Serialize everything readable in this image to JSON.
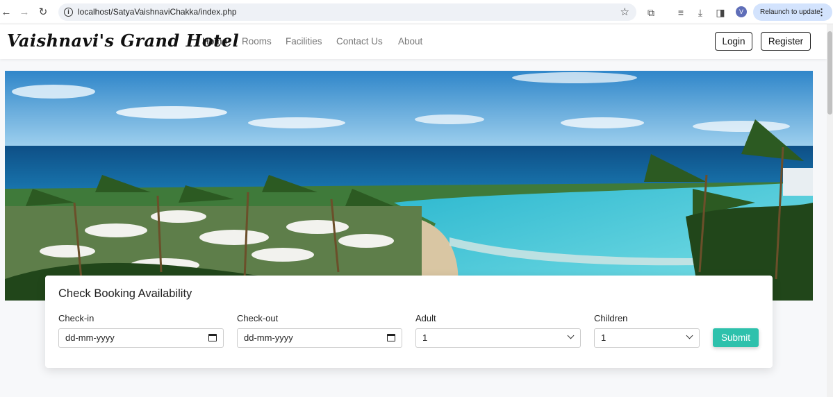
{
  "browser": {
    "url": "localhost/SatyaVaishnaviChakka/index.php",
    "profile_initial": "V",
    "relaunch_label": "Relaunch to update"
  },
  "site": {
    "brand": "Vaishnavi's Grand Hotel",
    "nav": [
      {
        "label": "Home",
        "active": true
      },
      {
        "label": "Rooms",
        "active": false
      },
      {
        "label": "Facilities",
        "active": false
      },
      {
        "label": "Contact Us",
        "active": false
      },
      {
        "label": "About",
        "active": false
      }
    ],
    "login_label": "Login",
    "register_label": "Register"
  },
  "booking": {
    "title": "Check Booking Availability",
    "checkin_label": "Check-in",
    "checkin_value": "dd-mm-yyyy",
    "checkout_label": "Check-out",
    "checkout_value": "dd-mm-yyyy",
    "adult_label": "Adult",
    "adult_value": "1",
    "children_label": "Children",
    "children_value": "1",
    "submit_label": "Submit"
  },
  "colors": {
    "accent": "#2ec1ac",
    "sea": "#1a6fa8",
    "pool": "#38c4d4"
  }
}
